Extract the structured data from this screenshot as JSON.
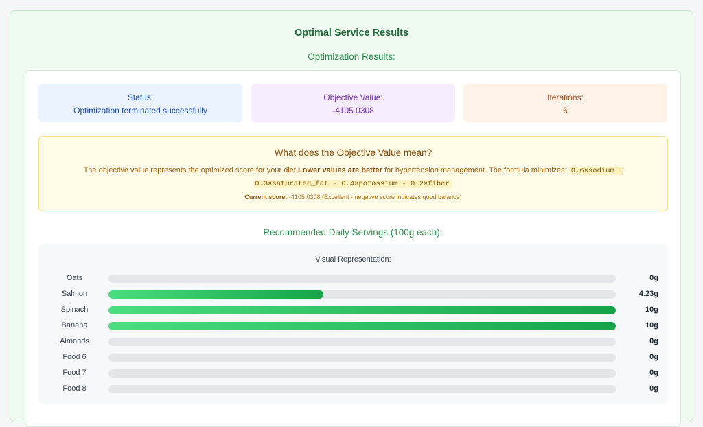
{
  "page": {
    "title": "Optimal Service Results",
    "subtitle": "Optimization Results:"
  },
  "cards": {
    "status": {
      "label": "Status:",
      "value": "Optimization terminated successfully"
    },
    "objective": {
      "label": "Objective Value:",
      "value": "-4105.0308"
    },
    "iterations": {
      "label": "Iterations:",
      "value": "6"
    }
  },
  "explanation": {
    "heading": "What does the Objective Value mean?",
    "text_before": "The objective value represents the optimized score for your diet.",
    "bold_phrase": "Lower values are better",
    "text_after": " for hypertension management. The formula minimizes: ",
    "formula": "0.6×sodium + 0.3×saturated_fat - 0.4×potassium - 0.2×fiber",
    "score_label": "Current score:",
    "score_text": " -4105.0308 (Excellent - negative score indicates good balance)"
  },
  "servings": {
    "title": "Recommended Daily Servings (100g each):",
    "visual_title": "Visual Representation:",
    "max": 10,
    "items": [
      {
        "name": "Oats",
        "value": 0,
        "label": "0g"
      },
      {
        "name": "Salmon",
        "value": 4.23,
        "label": "4.23g"
      },
      {
        "name": "Spinach",
        "value": 10,
        "label": "10g"
      },
      {
        "name": "Banana",
        "value": 10,
        "label": "10g"
      },
      {
        "name": "Almonds",
        "value": 0,
        "label": "0g"
      },
      {
        "name": "Food 6",
        "value": 0,
        "label": "0g"
      },
      {
        "name": "Food 7",
        "value": 0,
        "label": "0g"
      },
      {
        "name": "Food 8",
        "value": 0,
        "label": "0g"
      }
    ]
  },
  "colors": {
    "bar_start": "#4ade80",
    "bar_end": "#16a34a",
    "status_text": "#1e4fb0",
    "objective_text": "#7c2fb8",
    "iterations_text": "#b14a19"
  }
}
